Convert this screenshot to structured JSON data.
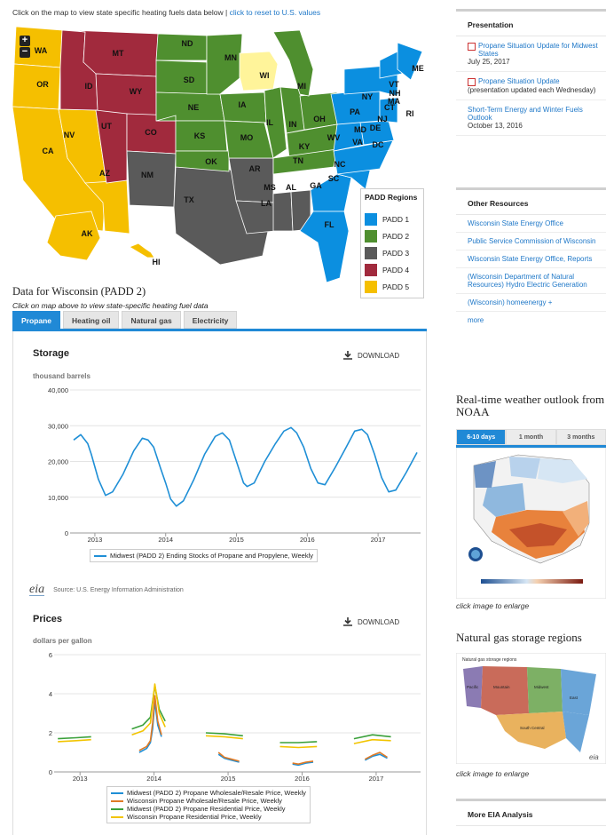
{
  "intro": {
    "text": "Click on the map to view state specific heating fuels data below |",
    "reset_link": "click to reset to U.S. values"
  },
  "map": {
    "zoom_in": "+",
    "zoom_out": "−",
    "states": [
      "WA",
      "OR",
      "CA",
      "ID",
      "NV",
      "MT",
      "WY",
      "UT",
      "AZ",
      "CO",
      "NM",
      "ND",
      "SD",
      "NE",
      "KS",
      "OK",
      "TX",
      "MN",
      "IA",
      "MO",
      "AR",
      "LA",
      "WI",
      "IL",
      "MI",
      "IN",
      "OH",
      "KY",
      "TN",
      "MS",
      "AL",
      "GA",
      "FL",
      "SC",
      "NC",
      "VA",
      "WV",
      "PA",
      "NY",
      "VT",
      "NH",
      "ME",
      "MA",
      "CT",
      "RI",
      "NJ",
      "DE",
      "MD",
      "DC",
      "AK",
      "HI"
    ],
    "colors": {
      "padd1": "#0b8fe0",
      "padd2": "#4f8f2f",
      "padd3": "#5a5a5a",
      "padd4": "#a12a3d",
      "padd5": "#f5bf00",
      "wisconsin": "#fff49a"
    }
  },
  "legend": {
    "title": "PADD Regions",
    "items": [
      {
        "label": "PADD 1",
        "color": "#0b8fe0"
      },
      {
        "label": "PADD 2",
        "color": "#4f8f2f"
      },
      {
        "label": "PADD 3",
        "color": "#5a5a5a"
      },
      {
        "label": "PADD 4",
        "color": "#a12a3d"
      },
      {
        "label": "PADD 5",
        "color": "#f5bf00"
      }
    ]
  },
  "data_title": "Data for Wisconsin (PADD 2)",
  "data_sub": "Click on map above to view state-specific heating fuel data",
  "tabs": [
    "Propane",
    "Heating oil",
    "Natural gas",
    "Electricity"
  ],
  "download_label": "DOWNLOAD",
  "source": {
    "logo": "eia",
    "text": "Source: U.S. Energy Information Administration"
  },
  "chart_data": [
    {
      "type": "line",
      "title": "Storage",
      "ylabel": "thousand barrels",
      "ylim": [
        0,
        40000
      ],
      "yticks": [
        "0",
        "10,000",
        "20,000",
        "30,000",
        "40,000"
      ],
      "xticks": [
        "2013",
        "2014",
        "2015",
        "2016",
        "2017"
      ],
      "grid": true,
      "legend": "bottom",
      "series": [
        {
          "name": "Midwest (PADD 2) Ending Stocks of Propane and Propylene, Weekly",
          "color": "#1f8fd6",
          "x": [
            2012.75,
            2012.85,
            2012.95,
            2013.0,
            2013.1,
            2013.2,
            2013.3,
            2013.45,
            2013.6,
            2013.72,
            2013.8,
            2013.88,
            2013.98,
            2014.05,
            2014.12,
            2014.2,
            2014.3,
            2014.45,
            2014.6,
            2014.75,
            2014.85,
            2014.95,
            2015.05,
            2015.15,
            2015.2,
            2015.3,
            2015.45,
            2015.6,
            2015.72,
            2015.82,
            2015.9,
            2016.0,
            2016.1,
            2016.2,
            2016.3,
            2016.45,
            2016.6,
            2016.72,
            2016.82,
            2016.9,
            2017.0,
            2017.1,
            2017.2,
            2017.3,
            2017.45,
            2017.6
          ],
          "y": [
            26000,
            27500,
            25000,
            22000,
            15000,
            10500,
            11500,
            16500,
            23000,
            26500,
            26000,
            24000,
            18000,
            14000,
            9500,
            7500,
            9000,
            15000,
            22000,
            27000,
            28000,
            26000,
            20000,
            14000,
            13000,
            14000,
            20000,
            25000,
            28500,
            29500,
            28000,
            24000,
            18000,
            14000,
            13500,
            18500,
            24000,
            28500,
            29000,
            27500,
            22000,
            15500,
            11500,
            12000,
            17000,
            22500
          ]
        }
      ]
    },
    {
      "type": "line",
      "title": "Prices",
      "ylabel": "dollars per gallon",
      "ylim": [
        0,
        6
      ],
      "yticks": [
        "0",
        "2",
        "4",
        "6"
      ],
      "xticks": [
        "2013",
        "2014",
        "2015",
        "2016",
        "2017"
      ],
      "grid": true,
      "legend": "bottom",
      "series": [
        {
          "name": "Midwest (PADD 2) Propane Wholesale/Resale Price, Weekly",
          "color": "#1f8fd6",
          "x": [
            2013.85,
            2013.95,
            2014.0,
            2014.03,
            2014.06,
            2014.1,
            2014.15,
            2014.92,
            2015.0,
            2015.1,
            2015.2,
            2015.92,
            2016.0,
            2016.1,
            2016.2,
            2016.9,
            2017.0,
            2017.1,
            2017.2
          ],
          "y": [
            1.0,
            1.2,
            1.5,
            2.2,
            3.6,
            2.4,
            1.8,
            0.9,
            0.7,
            0.6,
            0.5,
            0.4,
            0.35,
            0.45,
            0.5,
            0.6,
            0.8,
            0.9,
            0.7
          ]
        },
        {
          "name": "Wisconsin Propane Wholesale/Resale Price, Weekly",
          "color": "#e07a25",
          "x": [
            2013.85,
            2013.95,
            2014.0,
            2014.03,
            2014.06,
            2014.1,
            2014.15,
            2014.92,
            2015.0,
            2015.1,
            2015.2,
            2015.92,
            2016.0,
            2016.1,
            2016.2,
            2016.9,
            2017.0,
            2017.1,
            2017.2
          ],
          "y": [
            1.1,
            1.3,
            1.6,
            2.5,
            3.9,
            2.6,
            1.9,
            1.0,
            0.75,
            0.65,
            0.55,
            0.45,
            0.4,
            0.5,
            0.55,
            0.65,
            0.85,
            1.0,
            0.75
          ]
        },
        {
          "name": "Midwest (PADD 2) Propane Residential Price, Weekly",
          "color": "#3aa03a",
          "x": [
            2012.75,
            2013.0,
            2013.2,
            2013.75,
            2013.9,
            2014.0,
            2014.06,
            2014.12,
            2014.2,
            2014.75,
            2015.0,
            2015.25,
            2015.75,
            2016.0,
            2016.25,
            2016.75,
            2017.0,
            2017.25
          ],
          "y": [
            1.7,
            1.75,
            1.8,
            2.2,
            2.4,
            2.8,
            4.4,
            3.2,
            2.6,
            2.0,
            1.95,
            1.85,
            1.5,
            1.5,
            1.55,
            1.7,
            1.9,
            1.8
          ]
        },
        {
          "name": "Wisconsin Propane Residential Price, Weekly",
          "color": "#f2c400",
          "x": [
            2012.75,
            2013.0,
            2013.2,
            2013.75,
            2013.9,
            2014.0,
            2014.06,
            2014.12,
            2014.2,
            2014.75,
            2015.0,
            2015.25,
            2015.75,
            2016.0,
            2016.25,
            2016.75,
            2017.0,
            2017.25
          ],
          "y": [
            1.55,
            1.6,
            1.65,
            1.9,
            2.1,
            2.5,
            4.5,
            3.0,
            2.3,
            1.85,
            1.8,
            1.7,
            1.3,
            1.25,
            1.3,
            1.45,
            1.65,
            1.6
          ]
        }
      ]
    }
  ],
  "right": {
    "presentation": {
      "title": "Presentation",
      "items": [
        {
          "link": "Propane Situation Update for Midwest States",
          "date": "July 25, 2017",
          "pdf": true
        },
        {
          "link": "Propane Situation Update",
          "date": "(presentation updated each Wednesday)",
          "pdf": true
        },
        {
          "link": "Short-Term Energy and Winter Fuels Outlook",
          "date": "October 13, 2016",
          "pdf": false
        }
      ]
    },
    "other_resources": {
      "title": "Other Resources",
      "items": [
        "Wisconsin State Energy Office",
        "Public Service Commission of Wisconsin",
        "Wisconsin State Energy Office, Reports",
        "(Wisconsin Department of Natural Resources) Hydro Electric Generation",
        "(Wisconsin) homeenergy +",
        "more"
      ]
    },
    "noaa": {
      "title": "Real-time weather outlook from NOAA",
      "tabs": [
        "6-10 days",
        "1 month",
        "3 months"
      ],
      "caption": "click image to enlarge"
    },
    "ng_storage": {
      "title": "Natural gas storage regions",
      "map_title": "Natural gas storage regions",
      "regions": [
        "Pacific",
        "Mountain",
        "Midwest",
        "East",
        "South Central"
      ],
      "caption": "click image to enlarge"
    },
    "more_eia": {
      "title": "More EIA Analysis"
    }
  }
}
